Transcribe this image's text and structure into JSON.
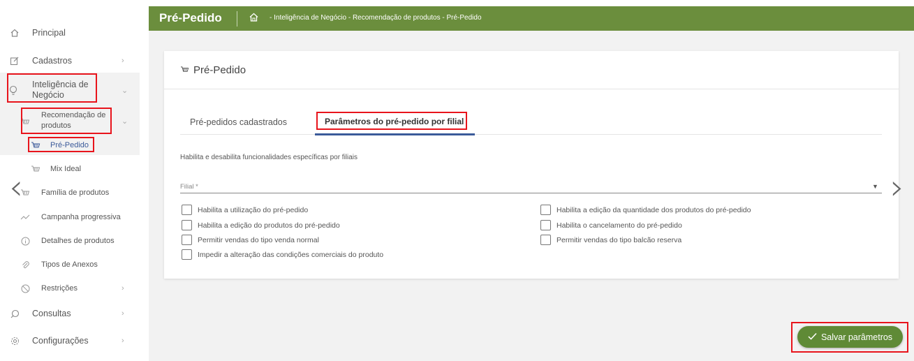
{
  "header": {
    "title": "Pré-Pedido",
    "breadcrumb": "- Inteligência de Negócio - Recomendação de produtos - Pré-Pedido"
  },
  "sidebar": {
    "items": [
      {
        "label": "Principal",
        "icon": "home-icon"
      },
      {
        "label": "Cadastros",
        "icon": "edit-icon"
      },
      {
        "label": "Inteligência de Negócio",
        "icon": "lightbulb-icon"
      },
      {
        "label": "Recomendação de produtos",
        "icon": "basket-icon"
      },
      {
        "label": "Pré-Pedido",
        "icon": "basket-icon"
      },
      {
        "label": "Mix Ideal",
        "icon": "basket-icon"
      },
      {
        "label": "Família de produtos",
        "icon": "basket-icon"
      },
      {
        "label": "Campanha progressiva",
        "icon": "trend-icon"
      },
      {
        "label": "Detalhes de produtos",
        "icon": "info-icon"
      },
      {
        "label": "Tipos de Anexos",
        "icon": "paperclip-icon"
      },
      {
        "label": "Restrições",
        "icon": "block-icon"
      },
      {
        "label": "Consultas",
        "icon": "search-icon"
      },
      {
        "label": "Configurações",
        "icon": "gear-icon"
      }
    ]
  },
  "card": {
    "title": "Pré-Pedido",
    "tabs": [
      "Pré-pedidos cadastrados",
      "Parâmetros do pré-pedido por filial"
    ],
    "description": "Habilita e desabilita funcionalidades específicas por filiais",
    "filial_label": "Filial *",
    "checkboxes_left": [
      "Habilita a utilização do pré-pedido",
      "Habilita a edição do produtos do pré-pedido",
      "Permitir vendas do tipo venda normal",
      "Impedir a alteração das condições comerciais do produto"
    ],
    "checkboxes_right": [
      "Habilita a edição da quantidade dos produtos do pré-pedido",
      "Habilita o cancelamento do pré-pedido",
      "Permitir vendas do tipo balcão reserva"
    ]
  },
  "save_button": "Salvar parâmetros",
  "colors": {
    "header": "#6b8e3d",
    "save_button": "#5f8a36",
    "highlight": "#e8141c",
    "tab_active": "#3b5b9a"
  }
}
